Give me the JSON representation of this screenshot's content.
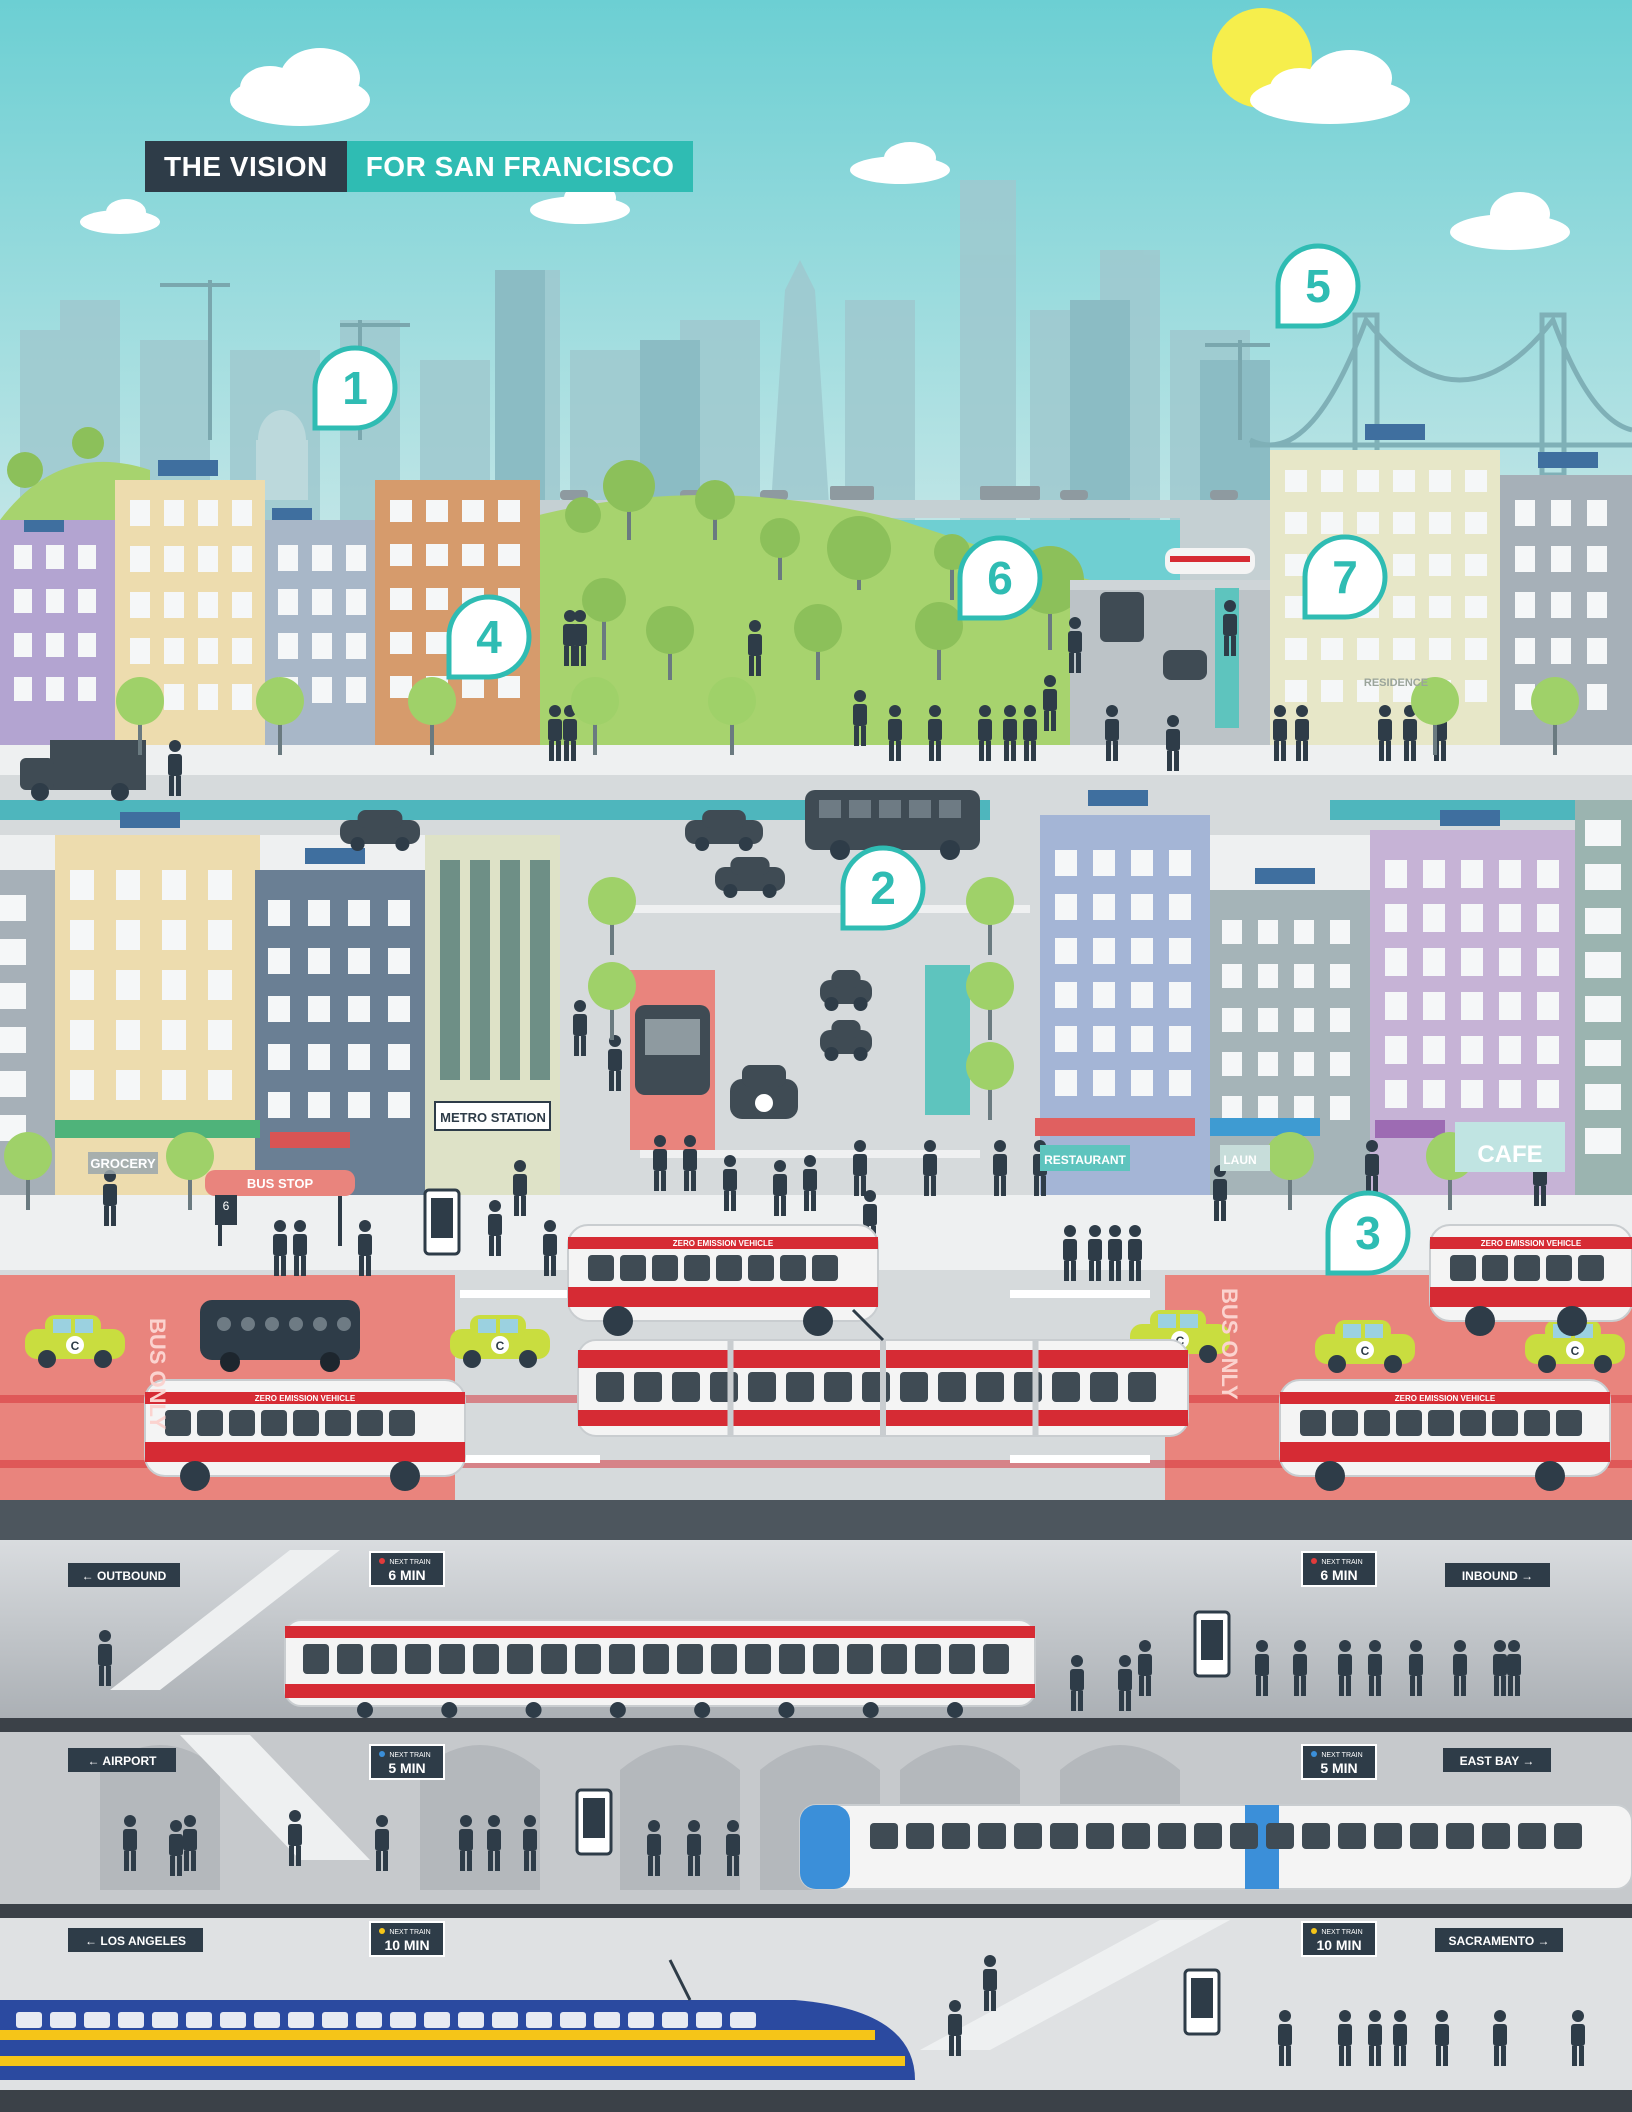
{
  "title": {
    "part1": "THE VISION",
    "part2": "FOR SAN FRANCISCO"
  },
  "callouts": [
    "1",
    "2",
    "3",
    "4",
    "5",
    "6",
    "7"
  ],
  "signs": {
    "metro_station": "METRO STATION",
    "bus_stop": "BUS STOP",
    "bus_stop_number": "6",
    "grocery": "GROCERY",
    "restaurant": "RESTAURANT",
    "laundry": "LAUN",
    "cafe": "CAFE",
    "residence": "RESIDENCE",
    "bus_only": "BUS ONLY",
    "zero_emission": "ZERO EMISSION VEHICLE",
    "car_logo": "C"
  },
  "stations": {
    "next_train_label": "NEXT TRAIN",
    "level1": {
      "left": "← OUTBOUND",
      "right": "INBOUND →",
      "time_left": "6 MIN",
      "time_right": "6 MIN"
    },
    "level2": {
      "left": "← AIRPORT",
      "right": "EAST BAY →",
      "time_left": "5 MIN",
      "time_right": "5 MIN"
    },
    "level3": {
      "left": "← LOS ANGELES",
      "right": "SACRAMENTO →",
      "time_left": "10 MIN",
      "time_right": "10 MIN"
    }
  },
  "colors": {
    "sky": "#6fcfd2",
    "teal": "#2fbcb3",
    "dark": "#2e3c48",
    "muni_red": "#d62b34",
    "bus_lane": "#e9847d",
    "bart_blue": "#3b8fd9",
    "hsr_yellow": "#f5c518",
    "hsr_blue": "#2b4aa0",
    "av_car": "#c9dd3f"
  }
}
